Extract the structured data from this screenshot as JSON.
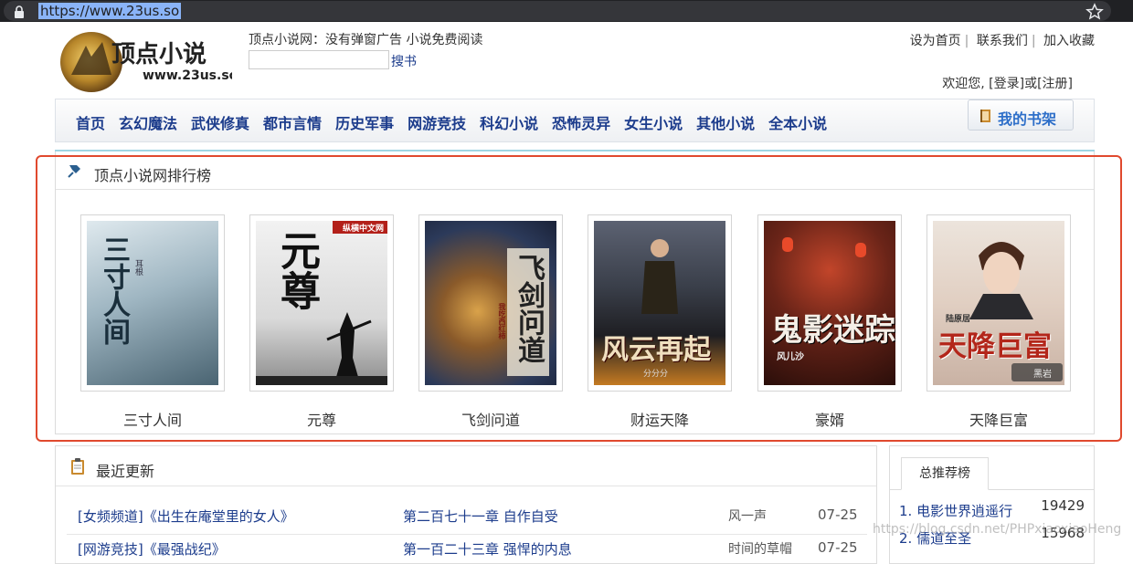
{
  "browser": {
    "url": "https://www.23us.so"
  },
  "header": {
    "logo_text": "顶点小说",
    "logo_domain": "www.23us.so",
    "slogan": "顶点小说网：没有弹窗广告 小说免费阅读",
    "search_value": "",
    "search_button": "搜书",
    "top_links": [
      "设为首页",
      "联系我们",
      "加入收藏"
    ],
    "welcome_prefix": "欢迎您,",
    "login": "[登录]",
    "or": "或",
    "register": "[注册]"
  },
  "nav": {
    "items": [
      "首页",
      "玄幻魔法",
      "武侠修真",
      "都市言情",
      "历史军事",
      "网游竞技",
      "科幻小说",
      "恐怖灵异",
      "女生小说",
      "其他小说",
      "全本小说"
    ],
    "shelf_label": "我的书架"
  },
  "ranking": {
    "title": "顶点小说网排行榜",
    "books": [
      {
        "name": "三寸人间",
        "cover_text": "三寸人间",
        "author_mark": "耳根"
      },
      {
        "name": "元尊",
        "cover_text": "元尊",
        "publisher": "纵横中文网"
      },
      {
        "name": "飞剑问道",
        "cover_text": "飞剑问道",
        "author_mark": "我吃西红柿"
      },
      {
        "name": "财运天降",
        "cover_text": "风云再起",
        "author_mark": "分分分"
      },
      {
        "name": "豪婿",
        "cover_text": "鬼影迷踪",
        "author_mark": "风儿沙"
      },
      {
        "name": "天降巨富",
        "cover_text": "天降巨富",
        "author_mark": "陆原居",
        "badge": "黑岩"
      }
    ],
    "cover_colors": [
      "#7f9aa8",
      "#e6e6e6",
      "#4a5a7a",
      "#3a3f4a",
      "#6a2418",
      "#e9dcd2"
    ]
  },
  "latest": {
    "title": "最近更新",
    "rows": [
      {
        "book": "[女频频道]《出生在庵堂里的女人》",
        "chapter": "第二百七十一章 自作自受",
        "author": "风一声",
        "date": "07-25"
      },
      {
        "book": "[网游竞技]《最强战纪》",
        "chapter": "第一百二十三章 强悍的内息",
        "author": "时间的草帽",
        "date": "07-25"
      }
    ]
  },
  "recommend": {
    "tab": "总推荐榜",
    "items": [
      {
        "name": "1. 电影世界逍遥行",
        "count": "19429"
      },
      {
        "name": "2. 儒道至圣",
        "count": "15968"
      }
    ]
  },
  "watermark": "https://blog.csdn.net/PHPxiaoxiaoHeng",
  "colors": {
    "nav_text": "#1c3c8c",
    "highlight_box": "#e0492e",
    "shelf_text": "#2e6fc9"
  }
}
